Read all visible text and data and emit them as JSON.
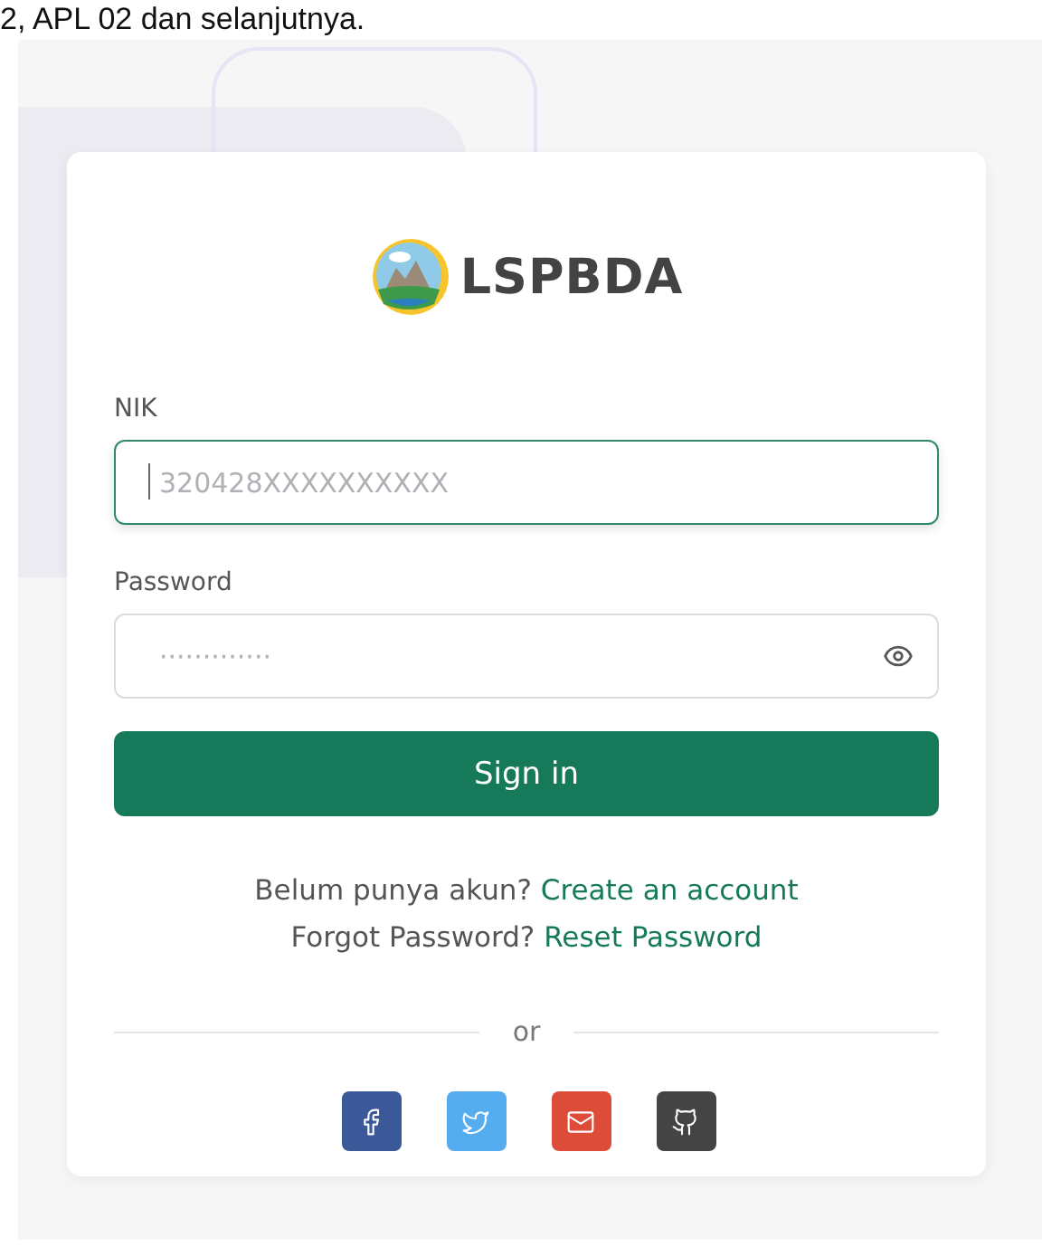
{
  "caption": "2, APL 02 dan selanjutnya.",
  "brand": {
    "name": "LSPBDA"
  },
  "fields": [
    {
      "label": "NIK",
      "placeholder": "320428XXXXXXXXXX",
      "focused": true,
      "reveal_toggle": false
    },
    {
      "label": "Password",
      "placeholder": "·············",
      "focused": false,
      "reveal_toggle": true
    }
  ],
  "submit": "Sign in",
  "prompts": [
    {
      "text": "Belum punya akun?",
      "link": "Create an account"
    },
    {
      "text": "Forgot Password?",
      "link": "Reset Password"
    }
  ],
  "divider": "or",
  "social": [
    {
      "kind": "facebook",
      "color": "#3b5998"
    },
    {
      "kind": "twitter",
      "color": "#55acee"
    },
    {
      "kind": "mail",
      "color": "#dd4b39"
    },
    {
      "kind": "github",
      "color": "#444444"
    }
  ]
}
